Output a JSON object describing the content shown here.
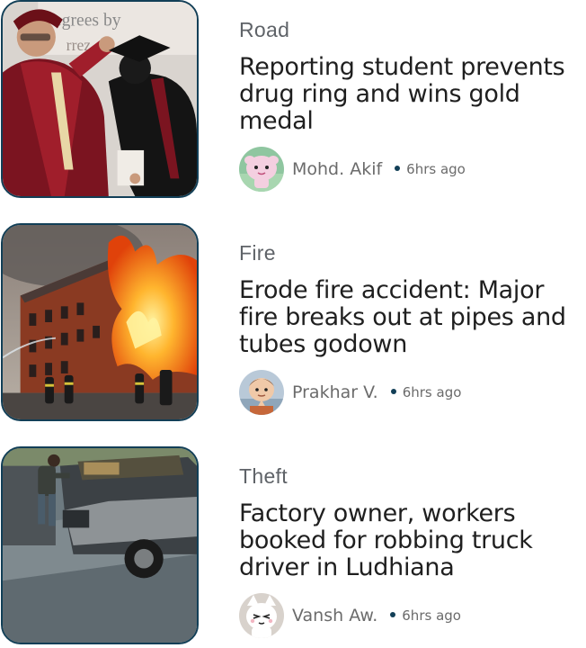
{
  "articles": [
    {
      "category": "Road",
      "headline": "Reporting student prevents drug ring and wins gold medal",
      "author": "Mohd. Akif",
      "time": "6hrs ago",
      "banner_text": "egrees by"
    },
    {
      "category": "Fire",
      "headline": "Erode fire accident: Major fire breaks out at pipes and tubes godown",
      "author": "Prakhar V.",
      "time": "6hrs ago"
    },
    {
      "category": "Theft",
      "headline": "Factory owner, workers booked for robbing truck driver in Ludhiana",
      "author": "Vansh Aw.",
      "time": "6hrs ago"
    }
  ],
  "colors": {
    "thumb_border": "#123f57",
    "dot": "#123f57",
    "category_text": "#5f6368",
    "headline_text": "#1f1f1f",
    "meta_text": "#6b6b6b"
  }
}
